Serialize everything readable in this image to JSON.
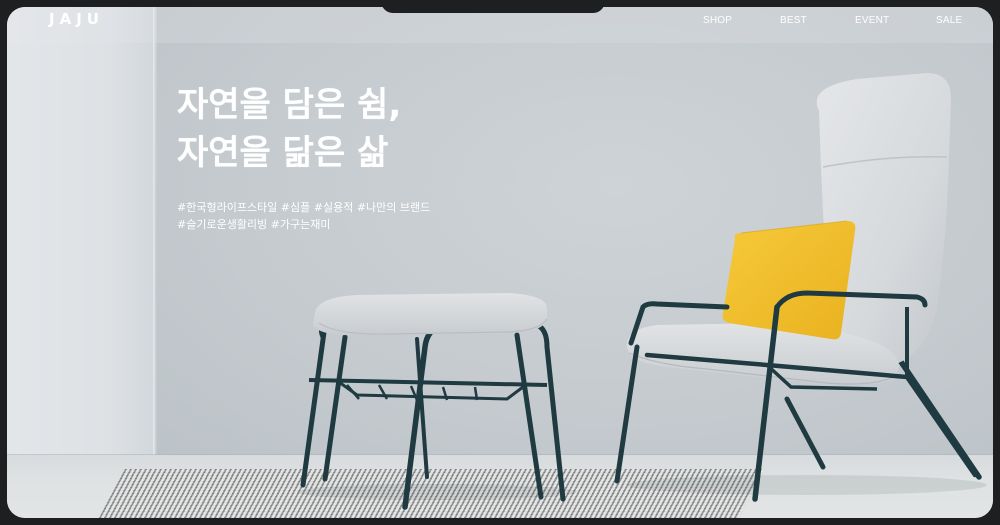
{
  "header": {
    "logo": "JAJU",
    "nav": [
      {
        "label": "SHOP"
      },
      {
        "label": "BEST"
      },
      {
        "label": "EVENT"
      },
      {
        "label": "SALE"
      }
    ]
  },
  "hero": {
    "headline_line1": "자연을 담은 쉼,",
    "headline_line2": "자연을 닮은 삶",
    "tags_line1": "#한국형라이프스타일 #심플 #실용적 #나만의 브랜드",
    "tags_line2": "#슬기로운생활리빙 #가구는재미"
  },
  "colors": {
    "frame": "#1e1f21",
    "wall": "#c7cdd2",
    "chair_fabric": "#dcdee0",
    "chair_frame": "#1f3a40",
    "pillow": "#f2c12e",
    "text": "#ffffff"
  }
}
